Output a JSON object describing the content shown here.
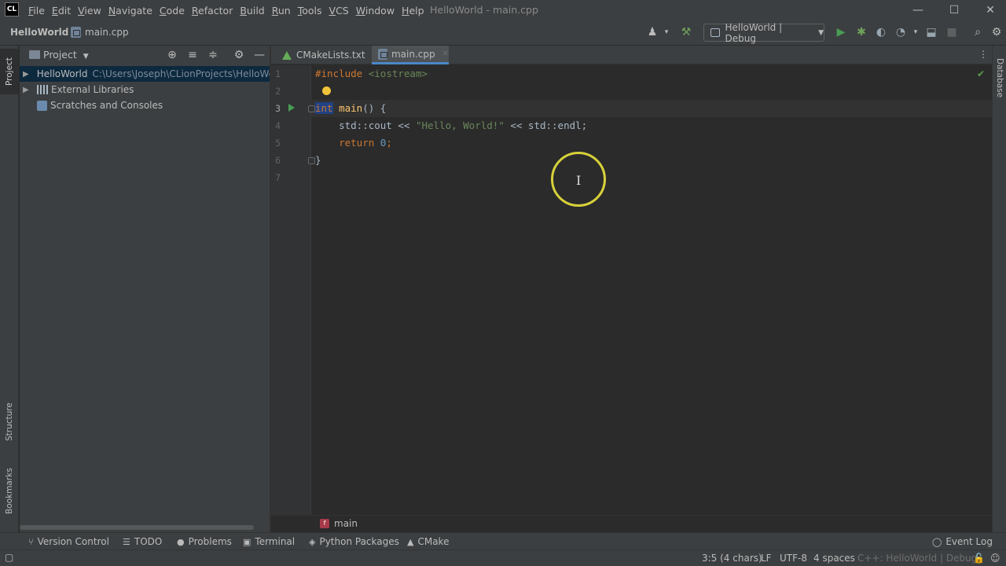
{
  "app": {
    "logo_text": "CL",
    "window_title": "HelloWorld - main.cpp"
  },
  "menu": [
    {
      "label": "File",
      "u": "F",
      "rest": "ile"
    },
    {
      "label": "Edit",
      "u": "E",
      "rest": "dit"
    },
    {
      "label": "View",
      "u": "V",
      "rest": "iew"
    },
    {
      "label": "Navigate",
      "u": "N",
      "rest": "avigate"
    },
    {
      "label": "Code",
      "u": "C",
      "rest": "ode"
    },
    {
      "label": "Refactor",
      "u": "R",
      "rest": "efactor"
    },
    {
      "label": "Build",
      "u": "B",
      "rest": "uild"
    },
    {
      "label": "Run",
      "u": "R",
      "rest": "un"
    },
    {
      "label": "Tools",
      "u": "T",
      "rest": "ools"
    },
    {
      "label": "VCS",
      "u": "V",
      "rest": "CS"
    },
    {
      "label": "Window",
      "u": "W",
      "rest": "indow"
    },
    {
      "label": "Help",
      "u": "H",
      "rest": "elp"
    }
  ],
  "window_controls": {
    "minimize": "—",
    "maximize": "☐",
    "close": "✕"
  },
  "navbar": {
    "project": "HelloWorld",
    "file": "main.cpp",
    "run_config": "HelloWorld | Debug"
  },
  "side_tabs": {
    "project": "Project",
    "structure": "Structure",
    "bookmarks": "Bookmarks",
    "database": "Database"
  },
  "project_panel": {
    "title": "Project",
    "tree": [
      {
        "label": "HelloWorld",
        "path": "C:\\Users\\Joseph\\CLionProjects\\HelloWo",
        "selected": true
      },
      {
        "label": "External Libraries",
        "path": ""
      },
      {
        "label": "Scratches and Consoles",
        "path": ""
      }
    ]
  },
  "tabs": [
    {
      "label": "CMakeLists.txt",
      "active": false
    },
    {
      "label": "main.cpp",
      "active": true
    }
  ],
  "editor": {
    "line_numbers": [
      "1",
      "2",
      "3",
      "4",
      "5",
      "6",
      "7"
    ],
    "current_line": 3,
    "code": {
      "l1_directive": "#include",
      "l1_header": " <iostream>",
      "l3_type": "int",
      "l3_fn": "main",
      "l3_rest": "() {",
      "l4_a": "    std::cout << ",
      "l4_str": "\"Hello, World!\"",
      "l4_b": " << std::endl;",
      "l5_kw": "    return",
      "l5_num": " 0",
      "l5_end": ";",
      "l6": "}"
    },
    "breadcrumb_fn_badge": "f",
    "breadcrumb_fn": "main"
  },
  "tool_windows": [
    {
      "label": "Version Control",
      "icon": "version-control-icon",
      "glyph": "⑂"
    },
    {
      "label": "TODO",
      "icon": "todo-icon",
      "glyph": "☰"
    },
    {
      "label": "Problems",
      "icon": "problems-icon",
      "glyph": "●"
    },
    {
      "label": "Terminal",
      "icon": "terminal-icon",
      "glyph": "▣"
    },
    {
      "label": "Python Packages",
      "icon": "packages-icon",
      "glyph": "◈"
    },
    {
      "label": "CMake",
      "icon": "cmake-icon",
      "glyph": "▲"
    }
  ],
  "event_log": "Event Log",
  "status": {
    "position": "3:5 (4 chars)",
    "line_sep": "LF",
    "encoding": "UTF-8",
    "indent": "4 spaces",
    "context": "C++: HelloWorld | Debug"
  },
  "colors": {
    "accent_tab": "#4a88c7",
    "run_green": "#499c54",
    "keyword": "#cc7832",
    "string": "#6a8759",
    "function": "#ffc66d",
    "number": "#6897bb",
    "selection": "#214283",
    "cursor_highlight": "#d7d13a"
  }
}
